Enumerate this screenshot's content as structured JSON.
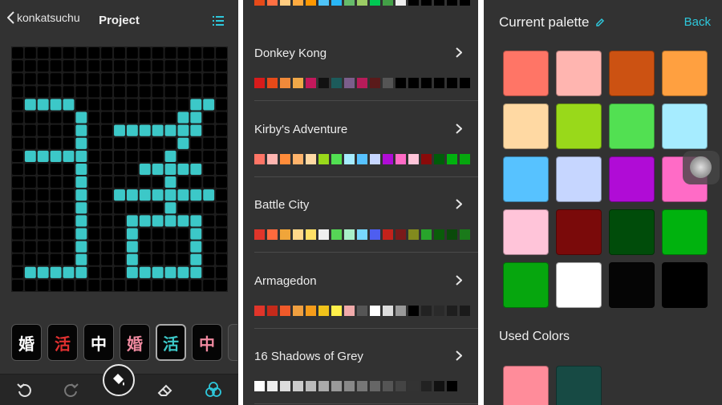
{
  "editor": {
    "back_label": "konkatsuchu",
    "title": "Project",
    "grid": {
      "cols": 17,
      "rows": 19,
      "on_color": "#3cc8c8",
      "off_color": "#000000",
      "pattern": [
        "00000000000000000",
        "00000000000000000",
        "00000000000000000",
        "00000000000000000",
        "01111000000000110",
        "00000100000001100",
        "00000100111111100",
        "00000100000001000",
        "01111100000010000",
        "00000100001111100",
        "00000100000010000",
        "00000100111111110",
        "00000100000010000",
        "00000100011111100",
        "00000100010000100",
        "00000100010000100",
        "00000100010000100",
        "01111100011111100",
        "00000000000000000"
      ]
    },
    "thumbnails": [
      {
        "char": "婚",
        "color": "#ffffff"
      },
      {
        "char": "活",
        "color": "#e03030"
      },
      {
        "char": "中",
        "color": "#ffffff"
      },
      {
        "char": "婚",
        "color": "#f08aa0"
      },
      {
        "char": "活",
        "color": "#3cc8c8"
      },
      {
        "char": "中",
        "color": "#f08aa0"
      }
    ],
    "selected_thumbnail": 4,
    "tools": [
      "undo-icon",
      "redo-icon",
      "fill-icon",
      "eraser-icon",
      "palette-icon"
    ]
  },
  "palettes": {
    "top_strip": [
      "#e64a19",
      "#ff7043",
      "#ffcc80",
      "#ffab40",
      "#ff9800",
      "#4fc3f7",
      "#29b6f6",
      "#66bb6a",
      "#9ccc65",
      "#00c853",
      "#43a047",
      "#eeeeee",
      "#000000",
      "#000000",
      "#000000",
      "#000000",
      "#000000"
    ],
    "items": [
      {
        "name": "Donkey Kong",
        "colors": [
          "#d81b1b",
          "#e64a19",
          "#f08a3a",
          "#f0a848",
          "#c2185b",
          "#111111",
          "#1c5b5b",
          "#7b5e8b",
          "#b71c5a",
          "#5a1a1a",
          "#555555",
          "#000000",
          "#000000",
          "#000000",
          "#000000",
          "#000000",
          "#000000"
        ]
      },
      {
        "name": "Kirby's Adventure",
        "colors": [
          "#ff7566",
          "#ffb5b0",
          "#ff8c3a",
          "#ffb36b",
          "#ffd9a3",
          "#99d91a",
          "#52e052",
          "#a6ecff",
          "#57c2ff",
          "#c6d6ff",
          "#b00cd6",
          "#ff6bc6",
          "#ffc4d9",
          "#8a0a0a",
          "#005c0a",
          "#00b20e",
          "#06a60e"
        ]
      },
      {
        "name": "Battle City",
        "colors": [
          "#e0352a",
          "#ff6a3d",
          "#f0a53a",
          "#ffd88a",
          "#ffe066",
          "#f0f0f0",
          "#56d456",
          "#a9f0c9",
          "#78d8ff",
          "#4e5ef0",
          "#c4221b",
          "#7a1a1a",
          "#828a1e",
          "#28a42b",
          "#0a5c0a",
          "#0a4a0a",
          "#1a7a1a"
        ]
      },
      {
        "name": "Armagedon",
        "colors": [
          "#e0352a",
          "#c42a1a",
          "#f05a2a",
          "#f0a040",
          "#f59c1a",
          "#f0c21a",
          "#fff04a",
          "#f0aaaa",
          "#555555",
          "#ffffff",
          "#dddddd",
          "#999999",
          "#000000",
          "#222222",
          "#2a2a2a",
          "#1e1e1e",
          "#1a1a1a"
        ]
      },
      {
        "name": "16 Shadows of Grey",
        "colors": [
          "#ffffff",
          "#eeeeee",
          "#dddddd",
          "#cccccc",
          "#bbbbbb",
          "#aaaaaa",
          "#999999",
          "#888888",
          "#777777",
          "#666666",
          "#555555",
          "#444444",
          "#333333",
          "#222222",
          "#111111",
          "#000000"
        ]
      }
    ]
  },
  "current": {
    "title": "Current palette",
    "back_label": "Back",
    "used_title": "Used Colors",
    "colors": [
      "#ff7566",
      "#ffb5b0",
      "#cc5212",
      "#ffa040",
      "#ffd9a3",
      "#99d91a",
      "#52e052",
      "#a6ecff",
      "#57c2ff",
      "#c6d6ff",
      "#b00cd6",
      "#ff6bc6",
      "#ffc4d9",
      "#7a0a0a",
      "#004c0a",
      "#00b20e",
      "#06a60e",
      "#ffffff",
      "#050505",
      "#000000"
    ],
    "used_colors": [
      "#ff8c9a",
      "#174a44"
    ]
  }
}
